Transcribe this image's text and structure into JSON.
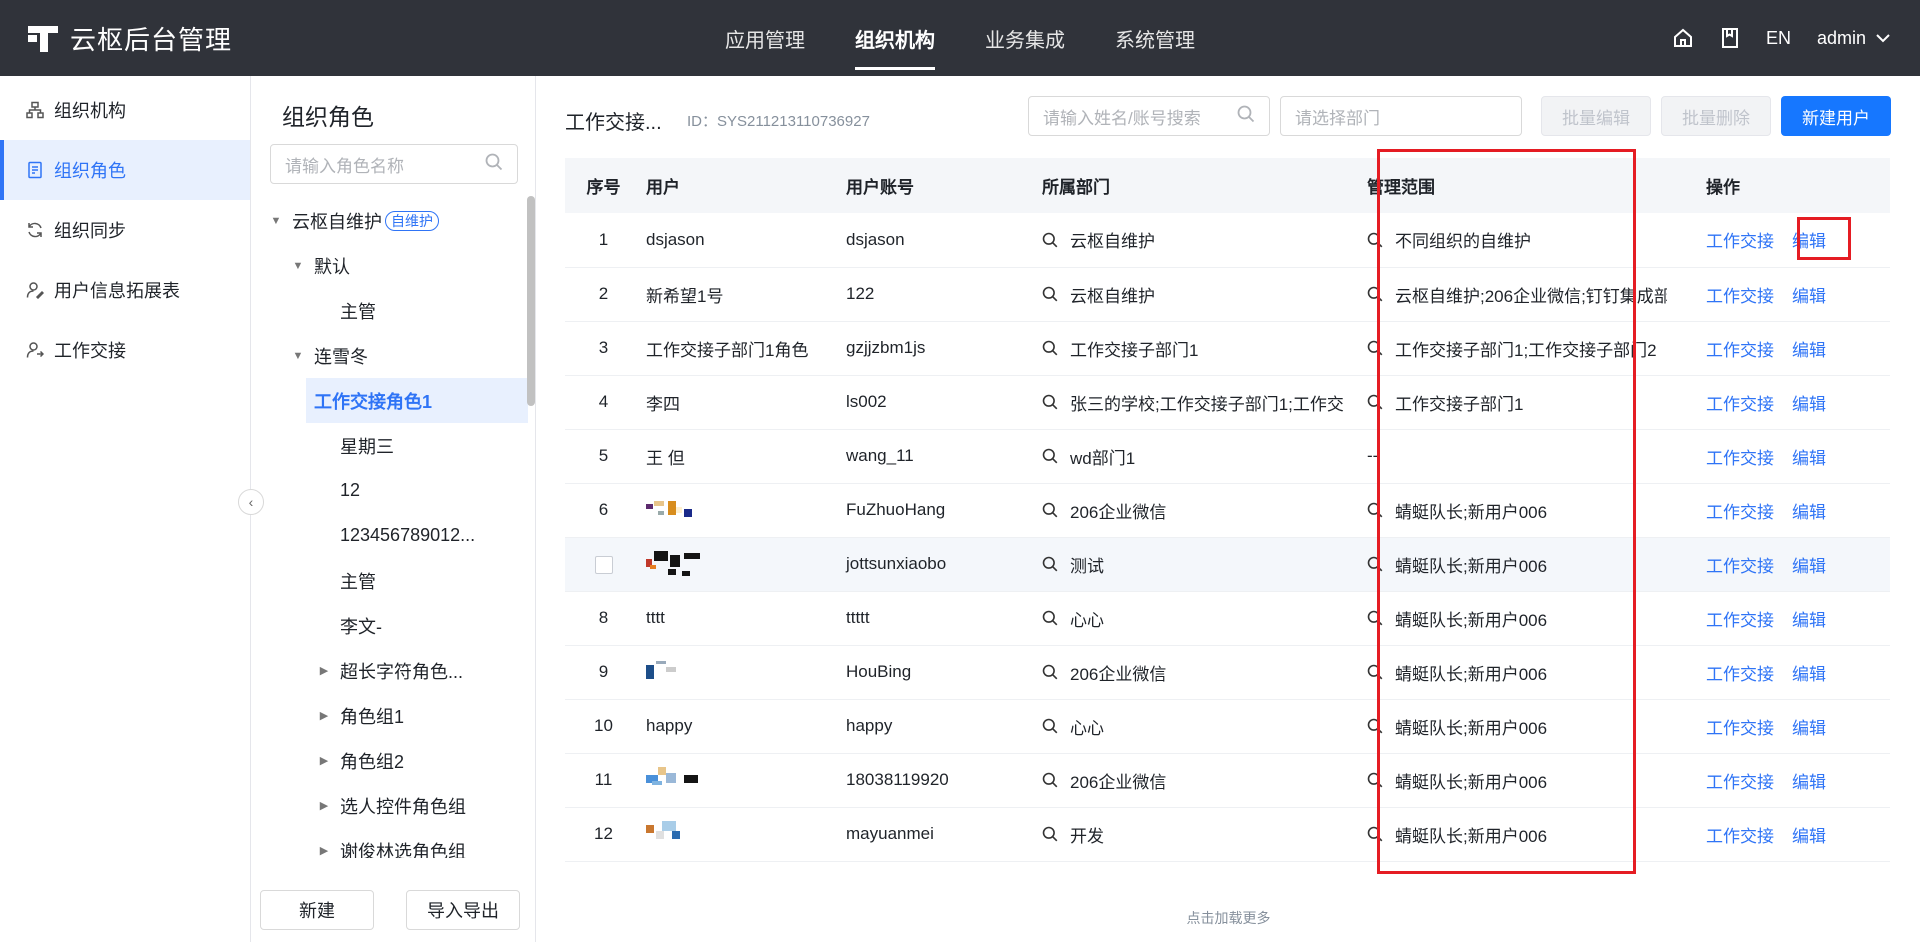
{
  "app": {
    "title": "云枢后台管理"
  },
  "topnav": [
    {
      "label": "应用管理",
      "active": false
    },
    {
      "label": "组织机构",
      "active": true
    },
    {
      "label": "业务集成",
      "active": false
    },
    {
      "label": "系统管理",
      "active": false
    }
  ],
  "topright": {
    "lang": "EN",
    "user": "admin"
  },
  "sidebar": [
    {
      "label": "组织机构",
      "icon": "org-icon",
      "active": false
    },
    {
      "label": "组织角色",
      "icon": "role-doc-icon",
      "active": true
    },
    {
      "label": "组织同步",
      "icon": "sync-icon",
      "active": false
    },
    {
      "label": "用户信息拓展表",
      "icon": "user-edit-icon",
      "active": false
    },
    {
      "label": "工作交接",
      "icon": "handover-icon",
      "active": false
    }
  ],
  "rolepanel": {
    "title": "组织角色",
    "search_placeholder": "请输入角色名称",
    "tree": [
      {
        "label": "云枢自维护",
        "tag": "自维护",
        "level": 0,
        "arrow": "down"
      },
      {
        "label": "默认",
        "level": 1,
        "arrow": "down"
      },
      {
        "label": "主管",
        "level": 2,
        "arrow": ""
      },
      {
        "label": "连雪冬",
        "level": 1,
        "arrow": "down"
      },
      {
        "label": "工作交接角色1",
        "level": 2,
        "arrow": "",
        "selected": true
      },
      {
        "label": "星期三",
        "level": 2,
        "arrow": ""
      },
      {
        "label": "12",
        "level": 2,
        "arrow": ""
      },
      {
        "label": "123456789012...",
        "level": 2,
        "arrow": ""
      },
      {
        "label": "主管",
        "level": 2,
        "arrow": ""
      },
      {
        "label": "李文-",
        "level": 2,
        "arrow": ""
      },
      {
        "label": "超长字符角色...",
        "level": 2,
        "arrow": "right"
      },
      {
        "label": "角色组1",
        "level": 2,
        "arrow": "right"
      },
      {
        "label": "角色组2",
        "level": 2,
        "arrow": "right"
      },
      {
        "label": "选人控件角色组",
        "level": 2,
        "arrow": "right"
      },
      {
        "label": "谢俊林选角色组",
        "level": 2,
        "arrow": "right"
      }
    ],
    "new_label": "新建",
    "import_export_label": "导入导出"
  },
  "main": {
    "title": "工作交接...",
    "id_text": "ID：SYS211213110736927",
    "search_placeholder": "请输入姓名/账号搜索",
    "dept_placeholder": "请选择部门",
    "batch_edit": "批量编辑",
    "batch_delete": "批量删除",
    "new_user": "新建用户",
    "columns": [
      "序号",
      "用户",
      "用户账号",
      "所属部门",
      "管理范围",
      "操作"
    ],
    "rows": [
      {
        "idx": "1",
        "user": "dsjason",
        "account": "dsjason",
        "dept": "云枢自维护",
        "scope": "不同组织的自维护"
      },
      {
        "idx": "2",
        "user": "新希望1号",
        "account": "122",
        "dept": "云枢自维护",
        "scope": "云枢自维护;206企业微信;钉钉集成部"
      },
      {
        "idx": "3",
        "user": "工作交接子部门1角色",
        "account": "gzjjzbm1js",
        "dept": "工作交接子部门1",
        "scope": "工作交接子部门1;工作交接子部门2"
      },
      {
        "idx": "4",
        "user": "李四",
        "account": "ls002",
        "dept": "张三的学校;工作交接子部门1;工作交",
        "scope": "工作交接子部门1"
      },
      {
        "idx": "5",
        "user": "王  但",
        "account": "wang_11",
        "dept": "wd部门1",
        "scope": "--"
      },
      {
        "idx": "6",
        "user": "",
        "account": "FuZhuoHang",
        "dept": "206企业微信",
        "scope": "蜻蜓队长;新用户006"
      },
      {
        "idx": "",
        "user": "",
        "account": "jottsunxiaobo",
        "dept": "测试",
        "scope": "蜻蜓队长;新用户006"
      },
      {
        "idx": "8",
        "user": "tttt",
        "account": "ttttt",
        "dept": "心心",
        "scope": "蜻蜓队长;新用户006"
      },
      {
        "idx": "9",
        "user": "",
        "account": "HouBing",
        "dept": "206企业微信",
        "scope": "蜻蜓队长;新用户006"
      },
      {
        "idx": "10",
        "user": "happy",
        "account": "happy",
        "dept": "心心",
        "scope": "蜻蜓队长;新用户006"
      },
      {
        "idx": "11",
        "user": "",
        "account": "18038119920",
        "dept": "206企业微信",
        "scope": "蜻蜓队长;新用户006"
      },
      {
        "idx": "12",
        "user": "",
        "account": "mayuanmei",
        "dept": "开发",
        "scope": "蜻蜓队长;新用户006"
      }
    ],
    "op_handover": "工作交接",
    "op_edit": "编辑",
    "load_more": "点击加载更多"
  },
  "colors": {
    "topbar": "#30333a",
    "accent": "#2f74f6",
    "primary_button": "#1677ff",
    "highlight": "#e51c23"
  }
}
